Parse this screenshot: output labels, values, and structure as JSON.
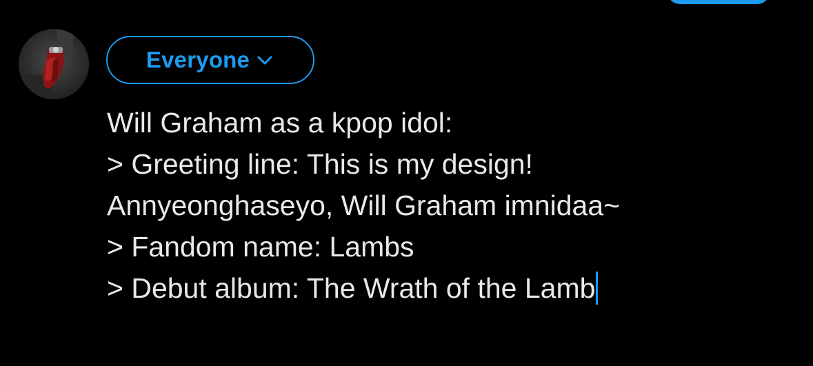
{
  "colors": {
    "background": "#000000",
    "accent": "#1d9bf0",
    "text": "#e7e9ea"
  },
  "audience": {
    "label": "Everyone",
    "icon": "chevron-down-icon"
  },
  "avatar": {
    "icon": "profile-avatar"
  },
  "compose": {
    "lines": [
      "Will Graham as a kpop idol:",
      "> Greeting line: This is my design! ",
      "Annyeonghaseyo, Will Graham imnidaa~",
      "> Fandom name: Lambs",
      "> Debut album: The Wrath of the Lamb"
    ]
  }
}
